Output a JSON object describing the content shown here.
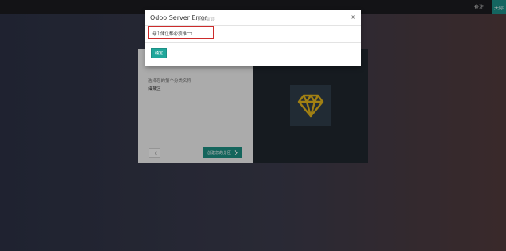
{
  "topbar": {
    "link_label": "备注",
    "user_label": "天际"
  },
  "onboarding": {
    "field_label": "选择您的第个分类名称",
    "field_value": "储藏区",
    "prev_label": "〈",
    "next_label": "创建您的分区"
  },
  "modal": {
    "title": "Odoo Server Error",
    "subtitle": "- 验证错误",
    "close_label": "×",
    "message": "每个储位都必须唯一!",
    "ok_label": "确定"
  },
  "colors": {
    "accent": "#20a79b",
    "error_border": "#cc2b2b",
    "dark_panel": "#1f262d",
    "diamond": "#e0b21b"
  }
}
